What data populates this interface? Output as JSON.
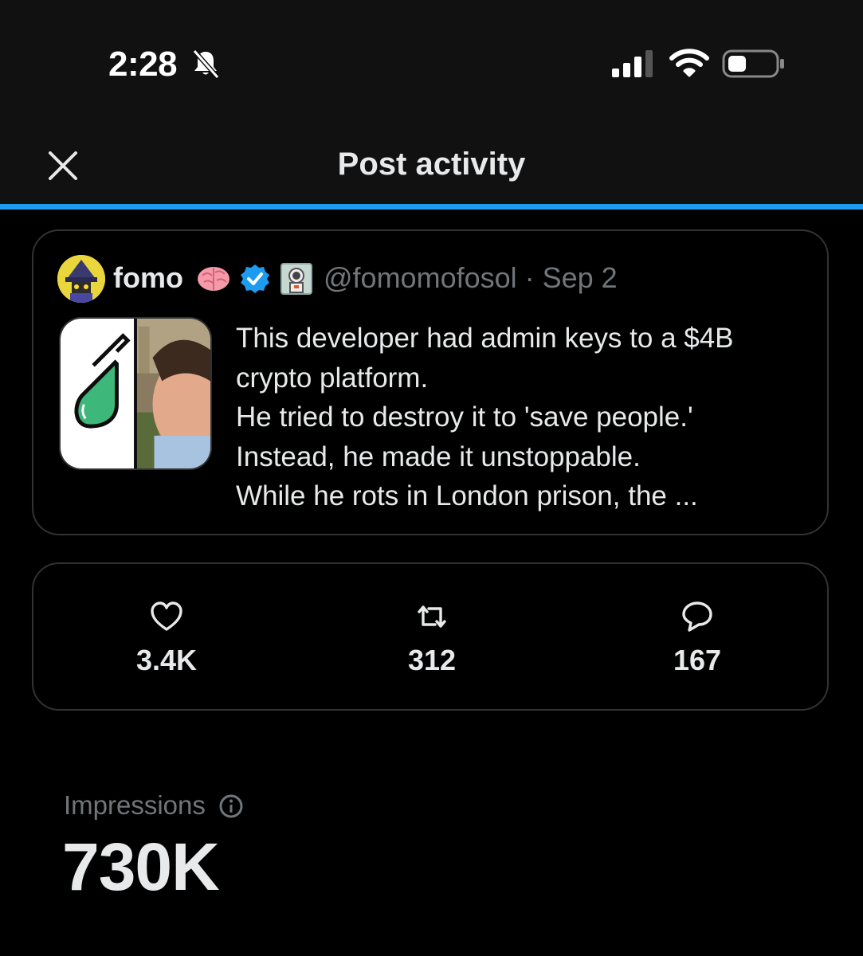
{
  "status_bar": {
    "time": "2:28",
    "icons": [
      "bell-slash-icon",
      "signal-icon",
      "wifi-icon",
      "battery-icon"
    ]
  },
  "header": {
    "title": "Post activity",
    "close_icon": "close-icon",
    "accent_color": "#1d9bf0"
  },
  "post": {
    "author_name": "fomo",
    "name_emojis": [
      "brain-emoji",
      "verified-badge-icon",
      "astronaut-emoji"
    ],
    "handle_date": "@fomomofosol · Sep 2",
    "text_lines": [
      "This developer had admin keys to a $4B",
      "crypto platform.",
      "He tried to destroy it to 'save people.'",
      "Instead, he made it unstoppable.",
      "While he rots in London prison, the ..."
    ]
  },
  "stats": {
    "likes": {
      "icon": "heart-icon",
      "value": "3.4K"
    },
    "reposts": {
      "icon": "repost-icon",
      "value": "312"
    },
    "replies": {
      "icon": "reply-icon",
      "value": "167"
    }
  },
  "impressions": {
    "label": "Impressions",
    "info_icon": "info-icon",
    "value": "730K"
  },
  "colors": {
    "background": "#000000",
    "text_primary": "#e7e9ea",
    "text_secondary": "#71767b",
    "border": "#2f3336",
    "verified": "#1d9bf0"
  }
}
